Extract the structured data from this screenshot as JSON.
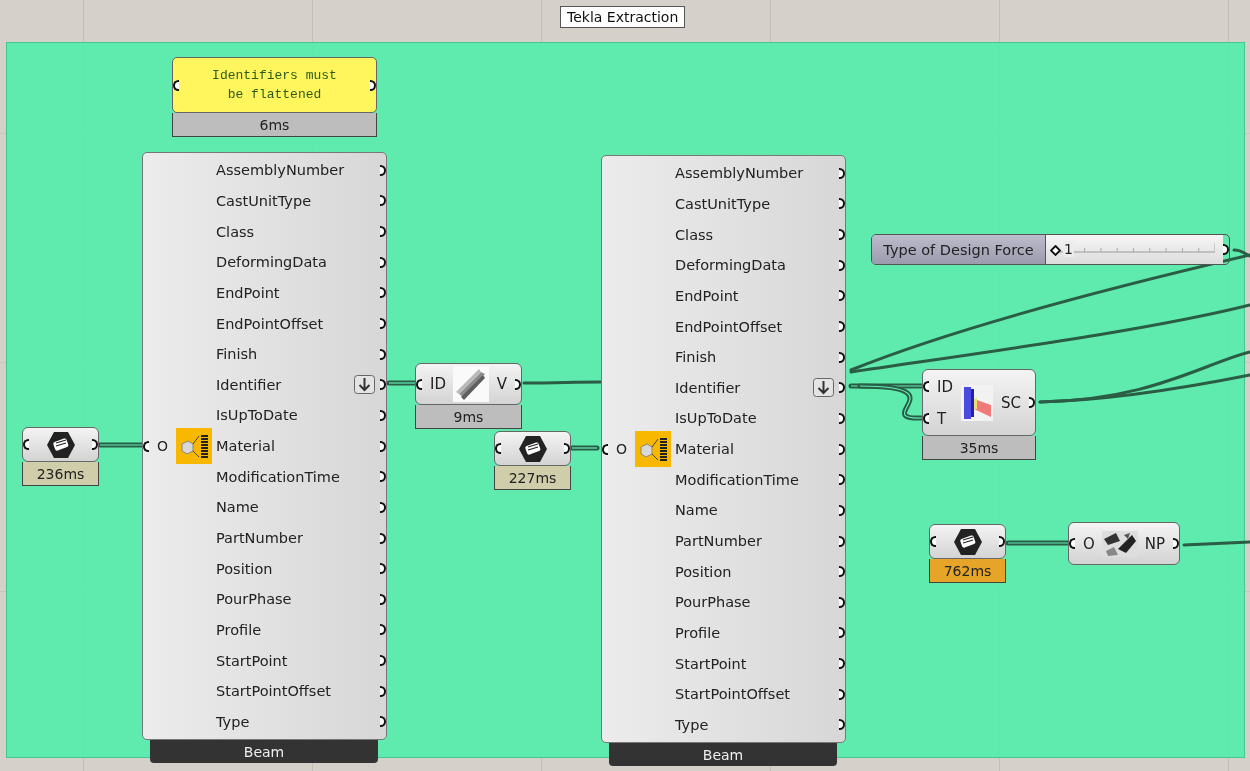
{
  "group": {
    "title": "Tekla Extraction"
  },
  "nodes": [
    {
      "kind": "panel",
      "text": "Identifiers must be flattened",
      "timing": {
        "text": "6ms",
        "color": "#bdbdbd"
      }
    },
    {
      "kind": "deconstruct",
      "input": "O",
      "footer": "Beam",
      "outputs": [
        {
          "label": "AssemblyNumber",
          "flattened": false
        },
        {
          "label": "CastUnitType",
          "flattened": false
        },
        {
          "label": "Class",
          "flattened": false
        },
        {
          "label": "DeformingData",
          "flattened": false
        },
        {
          "label": "EndPoint",
          "flattened": false
        },
        {
          "label": "EndPointOffset",
          "flattened": false
        },
        {
          "label": "Finish",
          "flattened": false
        },
        {
          "label": "Identifier",
          "flattened": true
        },
        {
          "label": "IsUpToDate",
          "flattened": false
        },
        {
          "label": "Material",
          "flattened": false
        },
        {
          "label": "ModificationTime",
          "flattened": false
        },
        {
          "label": "Name",
          "flattened": false
        },
        {
          "label": "PartNumber",
          "flattened": false
        },
        {
          "label": "Position",
          "flattened": false
        },
        {
          "label": "PourPhase",
          "flattened": false
        },
        {
          "label": "Profile",
          "flattened": false
        },
        {
          "label": "StartPoint",
          "flattened": false
        },
        {
          "label": "StartPointOffset",
          "flattened": false
        },
        {
          "label": "Type",
          "flattened": false
        }
      ]
    },
    {
      "kind": "picker",
      "timing": {
        "text": "236ms",
        "color": "#d0cdab"
      }
    },
    {
      "kind": "component",
      "inputs": [
        "ID"
      ],
      "outputs": [
        "V"
      ],
      "timing": {
        "text": "9ms",
        "color": "#bdbdbd"
      }
    },
    {
      "kind": "picker",
      "timing": {
        "text": "227ms",
        "color": "#d0cdab"
      }
    },
    {
      "kind": "deconstruct",
      "input": "O",
      "footer": "Beam",
      "outputs": [
        {
          "label": "AssemblyNumber",
          "flattened": false
        },
        {
          "label": "CastUnitType",
          "flattened": false
        },
        {
          "label": "Class",
          "flattened": false
        },
        {
          "label": "DeformingData",
          "flattened": false
        },
        {
          "label": "EndPoint",
          "flattened": false
        },
        {
          "label": "EndPointOffset",
          "flattened": false
        },
        {
          "label": "Finish",
          "flattened": false
        },
        {
          "label": "Identifier",
          "flattened": true
        },
        {
          "label": "IsUpToDate",
          "flattened": false
        },
        {
          "label": "Material",
          "flattened": false
        },
        {
          "label": "ModificationTime",
          "flattened": false
        },
        {
          "label": "Name",
          "flattened": false
        },
        {
          "label": "PartNumber",
          "flattened": false
        },
        {
          "label": "Position",
          "flattened": false
        },
        {
          "label": "PourPhase",
          "flattened": false
        },
        {
          "label": "Profile",
          "flattened": false
        },
        {
          "label": "StartPoint",
          "flattened": false
        },
        {
          "label": "StartPointOffset",
          "flattened": false
        },
        {
          "label": "Type",
          "flattened": false
        }
      ]
    },
    {
      "kind": "slider",
      "label": "Type of Design Force",
      "value": "1",
      "level": 0
    },
    {
      "kind": "component",
      "inputs": [
        "ID",
        "T"
      ],
      "outputs": [
        "SC"
      ],
      "timing": {
        "text": "35ms",
        "color": "#bdbdbd"
      }
    },
    {
      "kind": "picker",
      "timing": {
        "text": "762ms",
        "color": "#e6a528"
      }
    },
    {
      "kind": "component",
      "inputs": [
        "O"
      ],
      "outputs": [
        "NP"
      ]
    }
  ]
}
